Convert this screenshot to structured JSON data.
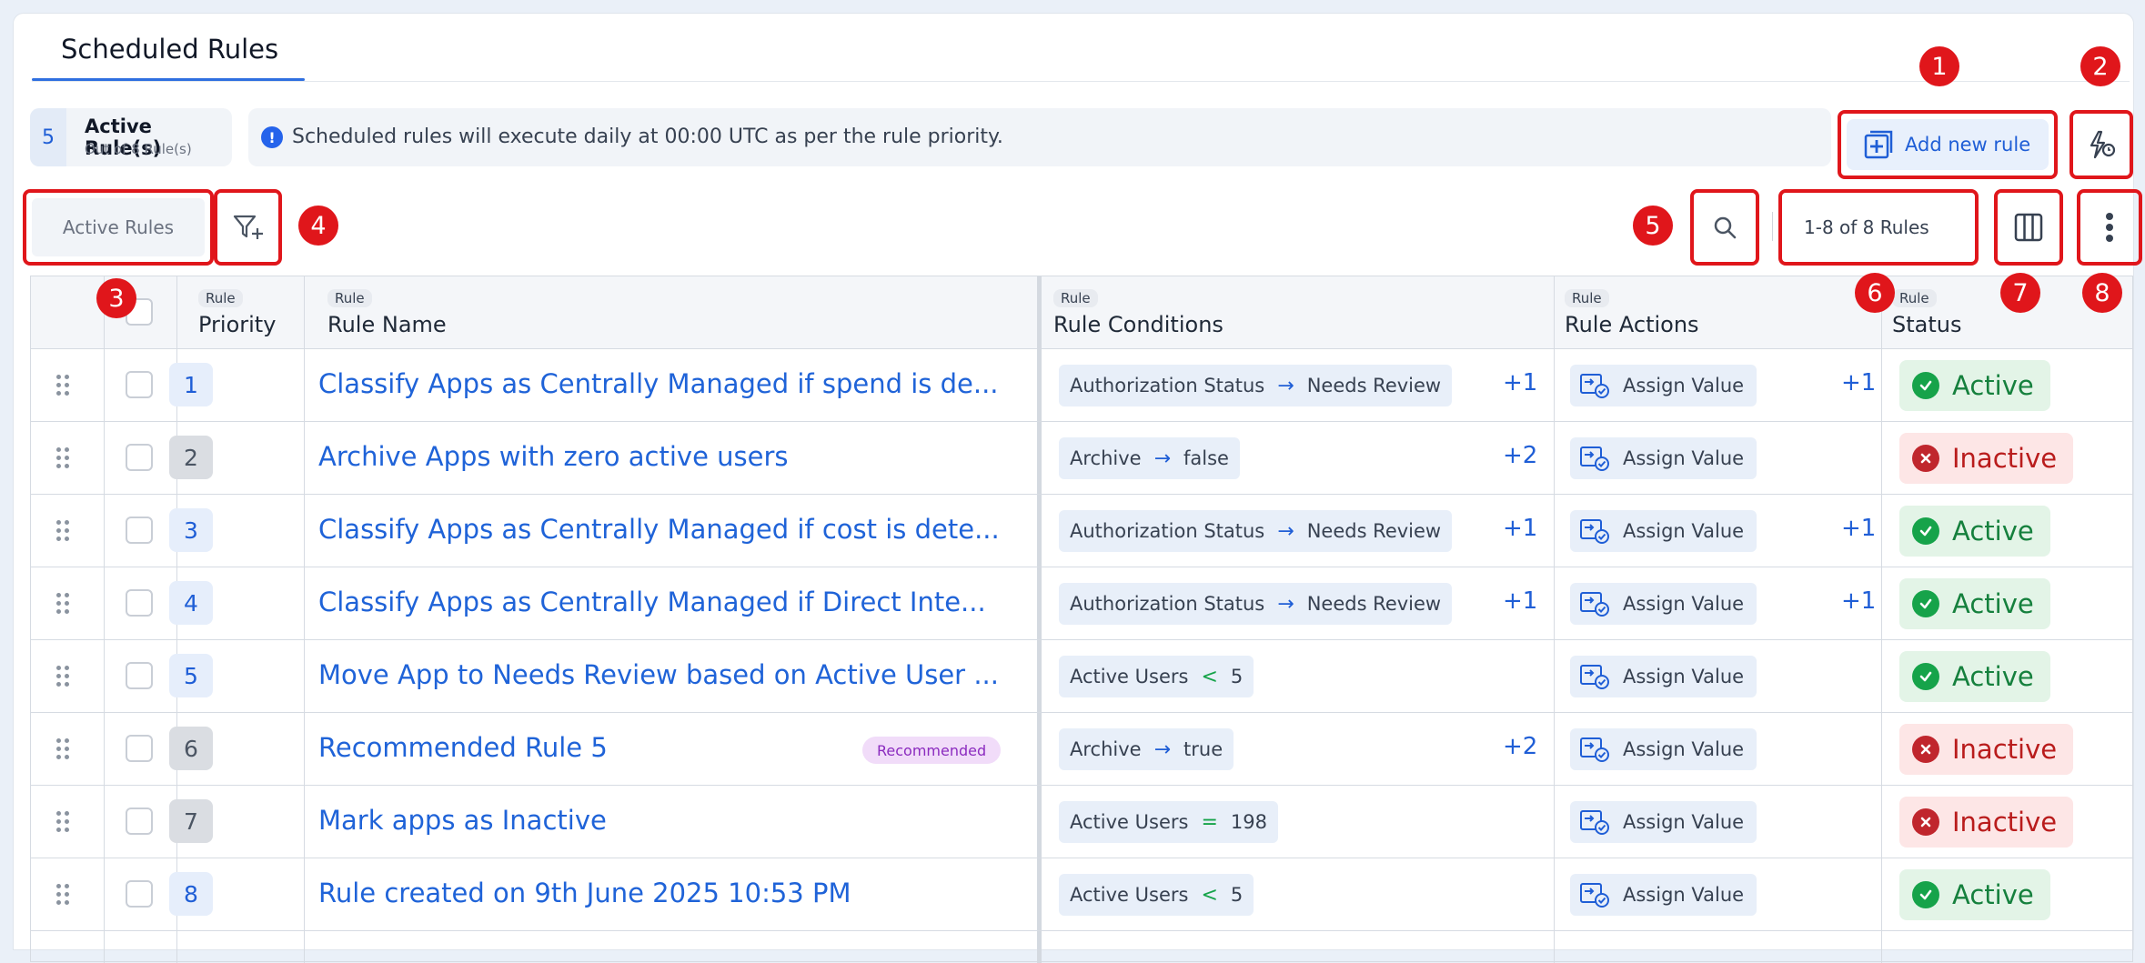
{
  "tabs": [
    {
      "label": "Scheduled Rules"
    }
  ],
  "summary": {
    "count": "5",
    "title": "Active Rule(s)",
    "subtitle": "Out of 8 Rule(s)"
  },
  "banner": {
    "icon": "info-icon",
    "text": "Scheduled rules will execute daily at 00:00 UTC as per the rule priority."
  },
  "toolbar": {
    "add_rule_label": "Add new rule",
    "filter_label": "Active Rules",
    "pager_text": "1-8 of 8 Rules"
  },
  "markers": [
    "1",
    "2",
    "3",
    "4",
    "5",
    "6",
    "7",
    "8"
  ],
  "columns": {
    "priority": {
      "small": "Rule",
      "main": "Priority"
    },
    "name": {
      "small": "Rule",
      "main": "Rule Name"
    },
    "conditions": {
      "small": "Rule",
      "main": "Rule Conditions"
    },
    "actions": {
      "small": "Rule",
      "main": "Rule Actions"
    },
    "status": {
      "small": "Rule",
      "main": "Status"
    }
  },
  "rows": [
    {
      "priority": "1",
      "name": "Classify Apps as Centrally Managed if spend is de...",
      "badge": "",
      "cond_field": "Authorization Status",
      "cond_op": "→",
      "cond_value": "Needs Review",
      "cond_more": "+1",
      "action": "Assign Value",
      "action_more": "+1",
      "status": "Active",
      "active": true
    },
    {
      "priority": "2",
      "name": "Archive Apps with zero active users",
      "badge": "",
      "cond_field": "Archive",
      "cond_op": "→",
      "cond_value": "false",
      "cond_more": "+2",
      "action": "Assign Value",
      "action_more": "",
      "status": "Inactive",
      "active": false
    },
    {
      "priority": "3",
      "name": "Classify Apps as Centrally Managed if cost is dete...",
      "badge": "",
      "cond_field": "Authorization Status",
      "cond_op": "→",
      "cond_value": "Needs Review",
      "cond_more": "+1",
      "action": "Assign Value",
      "action_more": "+1",
      "status": "Active",
      "active": true
    },
    {
      "priority": "4",
      "name": "Classify Apps as Centrally Managed if Direct Inte...",
      "badge": "",
      "cond_field": "Authorization Status",
      "cond_op": "→",
      "cond_value": "Needs Review",
      "cond_more": "+1",
      "action": "Assign Value",
      "action_more": "+1",
      "status": "Active",
      "active": true
    },
    {
      "priority": "5",
      "name": "Move App to Needs Review based on Active User ...",
      "badge": "",
      "cond_field": "Active Users",
      "cond_op": "<",
      "cond_value": "5",
      "cond_more": "",
      "action": "Assign Value",
      "action_more": "",
      "status": "Active",
      "active": true
    },
    {
      "priority": "6",
      "name": "Recommended Rule 5",
      "badge": "Recommended",
      "cond_field": "Archive",
      "cond_op": "→",
      "cond_value": "true",
      "cond_more": "+2",
      "action": "Assign Value",
      "action_more": "",
      "status": "Inactive",
      "active": false
    },
    {
      "priority": "7",
      "name": "Mark apps as Inactive",
      "badge": "",
      "cond_field": "Active Users",
      "cond_op": "=",
      "cond_value": "198",
      "cond_more": "",
      "action": "Assign Value",
      "action_more": "",
      "status": "Inactive",
      "active": false
    },
    {
      "priority": "8",
      "name": "Rule created on 9th June 2025 10:53 PM",
      "badge": "",
      "cond_field": "Active Users",
      "cond_op": "<",
      "cond_value": "5",
      "cond_more": "",
      "action": "Assign Value",
      "action_more": "",
      "status": "Active",
      "active": true
    }
  ],
  "colors": {
    "accent": "#1f5ed6",
    "highlight": "#e0161b",
    "active": "#16a34a",
    "inactive": "#c0262d",
    "badge": "#8b2bbf"
  }
}
